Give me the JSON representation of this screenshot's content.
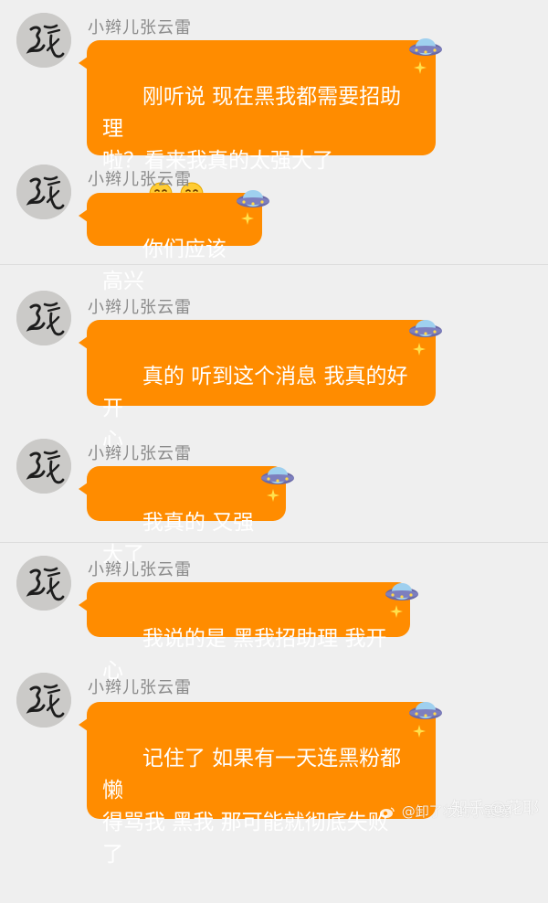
{
  "messages": [
    {
      "sender": "小辫儿张云雷",
      "text": "刚听说 现在黑我都需要招助理\n啦？看来我真的太强大了",
      "emoji_count": 4,
      "colors": {
        "bubble": "#ff8c00",
        "text": "#ffffff"
      }
    },
    {
      "sender": "小辫儿张云雷",
      "text": "你们应该 高兴",
      "emoji_count": 0
    },
    {
      "sender": "小辫儿张云雷",
      "text": "真的 听到这个消息 我真的好开\n心",
      "emoji_count": 0
    },
    {
      "sender": "小辫儿张云雷",
      "text": "我真的 又强大了",
      "emoji_count": 0
    },
    {
      "sender": "小辫儿张云雷",
      "text": "我说的是 黑我招助理 我开心",
      "emoji_count": 0
    },
    {
      "sender": "小辫儿张云雷",
      "text": "记住了 如果有一天连黑粉都懒\n得骂我 黑我 那可能就彻底失败\n了",
      "emoji_count": 0
    }
  ],
  "watermarks": {
    "zhihu": "知乎 @花耶",
    "weibo": "@卸了妆的小嫑嫑"
  },
  "icons": {
    "avatar": "zhang-calligraphy-avatar",
    "badge": "ufo-icon",
    "sparkle": "sparkle-icon",
    "emoji": "hush-face-emoji"
  },
  "colors": {
    "background": "#efefef",
    "bubble": "#ff8c00",
    "sender": "#8a8a8a"
  }
}
